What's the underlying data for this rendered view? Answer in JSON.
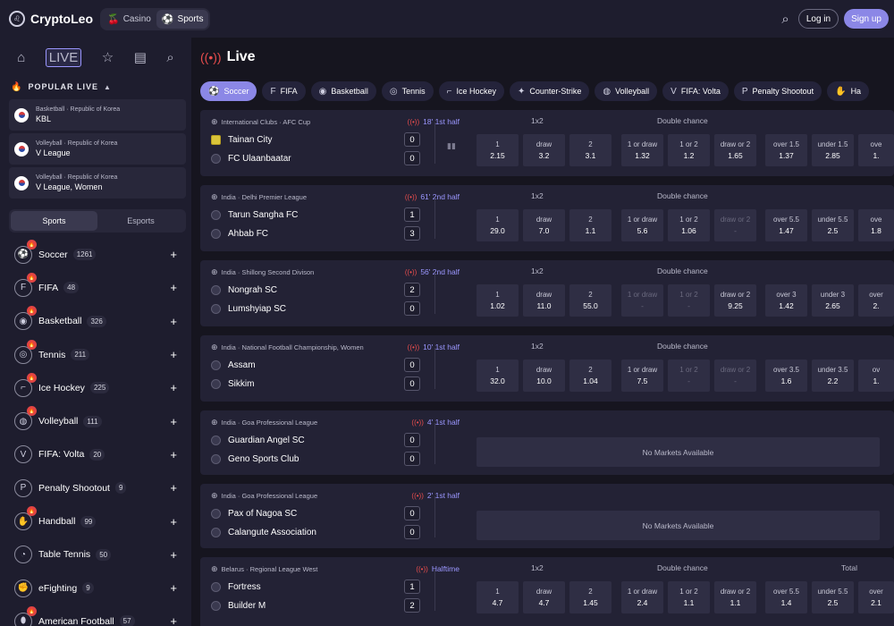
{
  "header": {
    "logo": "CryptoLeo",
    "modes": [
      {
        "label": "Casino",
        "icon": "cherries-icon"
      },
      {
        "label": "Sports",
        "icon": "soccer-ball-icon"
      }
    ],
    "login": "Log in",
    "signup": "Sign up"
  },
  "sidebar": {
    "popular_title": "POPULAR LIVE",
    "live_badge": "LIVE",
    "popular": [
      {
        "category": "Basketball · Republic of Korea",
        "name": "KBL"
      },
      {
        "category": "Volleyball · Republic of Korea",
        "name": "V League"
      },
      {
        "category": "Volleyball · Republic of Korea",
        "name": "V League, Women"
      }
    ],
    "tabs": [
      "Sports",
      "Esports"
    ],
    "sports": [
      {
        "name": "Soccer",
        "count": "1261",
        "icon": "soccer-icon",
        "hot": true
      },
      {
        "name": "FIFA",
        "count": "48",
        "icon": "fifa-icon",
        "hot": true
      },
      {
        "name": "Basketball",
        "count": "326",
        "icon": "basketball-icon",
        "hot": true
      },
      {
        "name": "Tennis",
        "count": "211",
        "icon": "tennis-icon",
        "hot": true
      },
      {
        "name": "Ice Hockey",
        "count": "225",
        "icon": "ice-hockey-icon",
        "hot": true
      },
      {
        "name": "Volleyball",
        "count": "111",
        "icon": "volleyball-icon",
        "hot": true
      },
      {
        "name": "FIFA: Volta",
        "count": "20",
        "icon": "fifa-volta-icon",
        "hot": false
      },
      {
        "name": "Penalty Shootout",
        "count": "9",
        "icon": "penalty-icon",
        "hot": false
      },
      {
        "name": "Handball",
        "count": "99",
        "icon": "handball-icon",
        "hot": true
      },
      {
        "name": "Table Tennis",
        "count": "50",
        "icon": "table-tennis-icon",
        "hot": false
      },
      {
        "name": "eFighting",
        "count": "9",
        "icon": "efighting-icon",
        "hot": false
      },
      {
        "name": "American Football",
        "count": "57",
        "icon": "american-football-icon",
        "hot": true
      }
    ]
  },
  "main": {
    "title": "Live",
    "filters": [
      "Soccer",
      "FIFA",
      "Basketball",
      "Tennis",
      "Ice Hockey",
      "Counter-Strike",
      "Volleyball",
      "FIFA: Volta",
      "Penalty Shootout",
      "Ha"
    ],
    "labels": {
      "one_x_two": "1x2",
      "double_chance": "Double chance",
      "total": "Total",
      "no_markets": "No Markets Available"
    },
    "matches": [
      {
        "league": "International Clubs · AFC Cup",
        "time": "18' 1st half",
        "home": "Tainan City",
        "away": "FC Ulaanbaatar",
        "hs": "0",
        "as": "0",
        "crest": true,
        "odds": [
          [
            "1",
            "2.15"
          ],
          [
            "draw",
            "3.2"
          ],
          [
            "2",
            "3.1"
          ],
          [
            "1 or draw",
            "1.32"
          ],
          [
            "1 or 2",
            "1.2"
          ],
          [
            "draw or 2",
            "1.65"
          ],
          [
            "over 1.5",
            "1.37"
          ],
          [
            "under 1.5",
            "2.85"
          ],
          [
            "ove",
            "1."
          ]
        ],
        "locked": []
      },
      {
        "league": "India · Delhi Premier League",
        "time": "61' 2nd half",
        "home": "Tarun Sangha FC",
        "away": "Ahbab FC",
        "hs": "1",
        "as": "3",
        "odds": [
          [
            "1",
            "29.0"
          ],
          [
            "draw",
            "7.0"
          ],
          [
            "2",
            "1.1"
          ],
          [
            "1 or draw",
            "5.6"
          ],
          [
            "1 or 2",
            "1.06"
          ],
          [
            "draw or 2",
            "-"
          ],
          [
            "over 5.5",
            "1.47"
          ],
          [
            "under 5.5",
            "2.5"
          ],
          [
            "ove",
            "1.8"
          ]
        ],
        "locked": [
          5
        ]
      },
      {
        "league": "India · Shillong Second Divison",
        "time": "56' 2nd half",
        "home": "Nongrah SC",
        "away": "Lumshyiap SC",
        "hs": "2",
        "as": "0",
        "odds": [
          [
            "1",
            "1.02"
          ],
          [
            "draw",
            "11.0"
          ],
          [
            "2",
            "55.0"
          ],
          [
            "1 or draw",
            "-"
          ],
          [
            "1 or 2",
            "-"
          ],
          [
            "draw or 2",
            "9.25"
          ],
          [
            "over 3",
            "1.42"
          ],
          [
            "under 3",
            "2.65"
          ],
          [
            "over",
            "2."
          ]
        ],
        "locked": [
          3,
          4
        ]
      },
      {
        "league": "India · National Football Championship, Women",
        "time": "10' 1st half",
        "home": "Assam",
        "away": "Sikkim",
        "hs": "0",
        "as": "0",
        "odds": [
          [
            "1",
            "32.0"
          ],
          [
            "draw",
            "10.0"
          ],
          [
            "2",
            "1.04"
          ],
          [
            "1 or draw",
            "7.5"
          ],
          [
            "1 or 2",
            "-"
          ],
          [
            "draw or 2",
            "-"
          ],
          [
            "over 3.5",
            "1.6"
          ],
          [
            "under 3.5",
            "2.2"
          ],
          [
            "ov",
            "1."
          ]
        ],
        "locked": [
          4,
          5
        ]
      },
      {
        "league": "India · Goa Professional League",
        "time": "4' 1st half",
        "home": "Guardian Angel SC",
        "away": "Geno Sports Club",
        "hs": "0",
        "as": "0",
        "nomarkets": true
      },
      {
        "league": "India · Goa Professional League",
        "time": "2' 1st half",
        "home": "Pax of Nagoa SC",
        "away": "Calangute Association",
        "hs": "0",
        "as": "0",
        "nomarkets": true
      },
      {
        "league": "Belarus · Regional League West",
        "time": "Halftime",
        "home": "Fortress",
        "away": "Builder M",
        "hs": "1",
        "as": "2",
        "show_total": true,
        "odds": [
          [
            "1",
            "4.7"
          ],
          [
            "draw",
            "4.7"
          ],
          [
            "2",
            "1.45"
          ],
          [
            "1 or draw",
            "2.4"
          ],
          [
            "1 or 2",
            "1.1"
          ],
          [
            "draw or 2",
            "1.1"
          ],
          [
            "over 5.5",
            "1.4"
          ],
          [
            "under 5.5",
            "2.5"
          ],
          [
            "over",
            "2.1"
          ]
        ],
        "locked": []
      }
    ]
  }
}
